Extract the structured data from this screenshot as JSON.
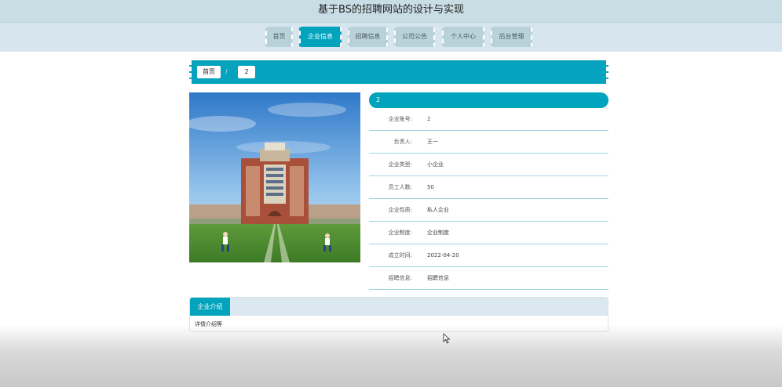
{
  "site": {
    "title": "基于BS的招聘网站的设计与实现"
  },
  "nav": {
    "items": [
      {
        "label": "首页"
      },
      {
        "label": "企业信息"
      },
      {
        "label": "招聘信息"
      },
      {
        "label": "公司公告"
      },
      {
        "label": "个人中心"
      },
      {
        "label": "后台管理"
      }
    ],
    "active": "企业信息"
  },
  "breadcrumb": {
    "home": "首页",
    "separator": "/",
    "current": "2"
  },
  "company": {
    "name": "2",
    "fields": [
      {
        "label": "企业账号:",
        "value": "2"
      },
      {
        "label": "负责人:",
        "value": "王一"
      },
      {
        "label": "企业类型:",
        "value": "小企业"
      },
      {
        "label": "员工人数:",
        "value": "50"
      },
      {
        "label": "企业性质:",
        "value": "私人企业"
      },
      {
        "label": "企业制度:",
        "value": "企业制度"
      },
      {
        "label": "成立时间:",
        "value": "2022-04-20"
      },
      {
        "label": "招聘信息:",
        "value": "招聘信息"
      }
    ]
  },
  "intro": {
    "tab": "企业介绍",
    "content": "详情介绍等"
  },
  "colors": {
    "accent": "#02a3bd",
    "topbar": "#c9dde5",
    "navbar": "#d6e5ee"
  },
  "icons": {
    "cursor": "mouse-cursor-icon"
  }
}
